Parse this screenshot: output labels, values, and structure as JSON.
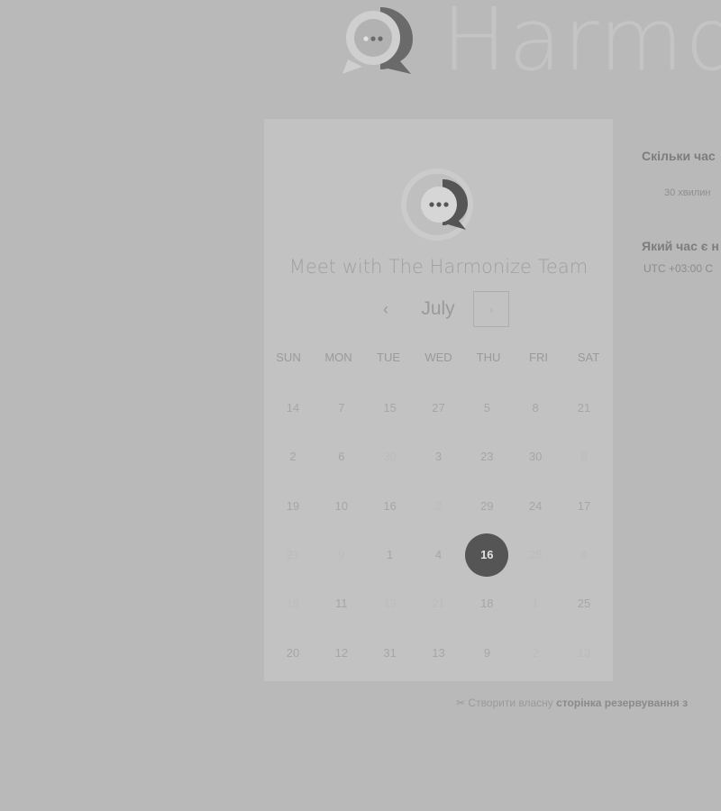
{
  "brand": {
    "name": "Harmonize"
  },
  "card": {
    "title": "Meet with The Harmonize Team",
    "month": "July",
    "prev_label": "‹",
    "next_label": "›"
  },
  "weekdays": [
    "SUN",
    "MON",
    "TUE",
    "WED",
    "THU",
    "FRI",
    "SAT"
  ],
  "calendar": [
    [
      {
        "d": "14"
      },
      {
        "d": "7"
      },
      {
        "d": "15"
      },
      {
        "d": "27"
      },
      {
        "d": "5"
      },
      {
        "d": "8"
      },
      {
        "d": "21"
      }
    ],
    [
      {
        "d": "2"
      },
      {
        "d": "6"
      },
      {
        "d": "30",
        "faint": true
      },
      {
        "d": "3"
      },
      {
        "d": "23"
      },
      {
        "d": "30"
      },
      {
        "d": "8",
        "faint": true
      }
    ],
    [
      {
        "d": "19"
      },
      {
        "d": "10"
      },
      {
        "d": "16"
      },
      {
        "d": "2",
        "faint": true
      },
      {
        "d": "29"
      },
      {
        "d": "24"
      },
      {
        "d": "17"
      }
    ],
    [
      {
        "d": "21",
        "faint": true
      },
      {
        "d": "9",
        "faint": true
      },
      {
        "d": "1"
      },
      {
        "d": "4"
      },
      {
        "d": "16",
        "selected": true
      },
      {
        "d": "28",
        "faint": true
      },
      {
        "d": "4",
        "faint": true
      }
    ],
    [
      {
        "d": "19",
        "faint": true
      },
      {
        "d": "11"
      },
      {
        "d": "13",
        "faint": true
      },
      {
        "d": "21",
        "faint": true
      },
      {
        "d": "18"
      },
      {
        "d": "1",
        "faint": true
      },
      {
        "d": "25"
      }
    ],
    [
      {
        "d": "20"
      },
      {
        "d": "12"
      },
      {
        "d": "31"
      },
      {
        "d": "13"
      },
      {
        "d": "9"
      },
      {
        "d": "2",
        "faint": true
      },
      {
        "d": "13",
        "faint": true
      }
    ]
  ],
  "right_panel": {
    "duration_question": "Скільки час",
    "duration_option": "30 хвилин",
    "time_question": "Який час є н",
    "timezone": "UTC +03:00 С"
  },
  "footer": {
    "icon": "scissors-icon",
    "prefix": "Створити власну ",
    "link": "сторінка резервування з"
  },
  "colors": {
    "background": "#b9b9b9",
    "card": "#c2c2c2",
    "selected_day": "#555555"
  }
}
